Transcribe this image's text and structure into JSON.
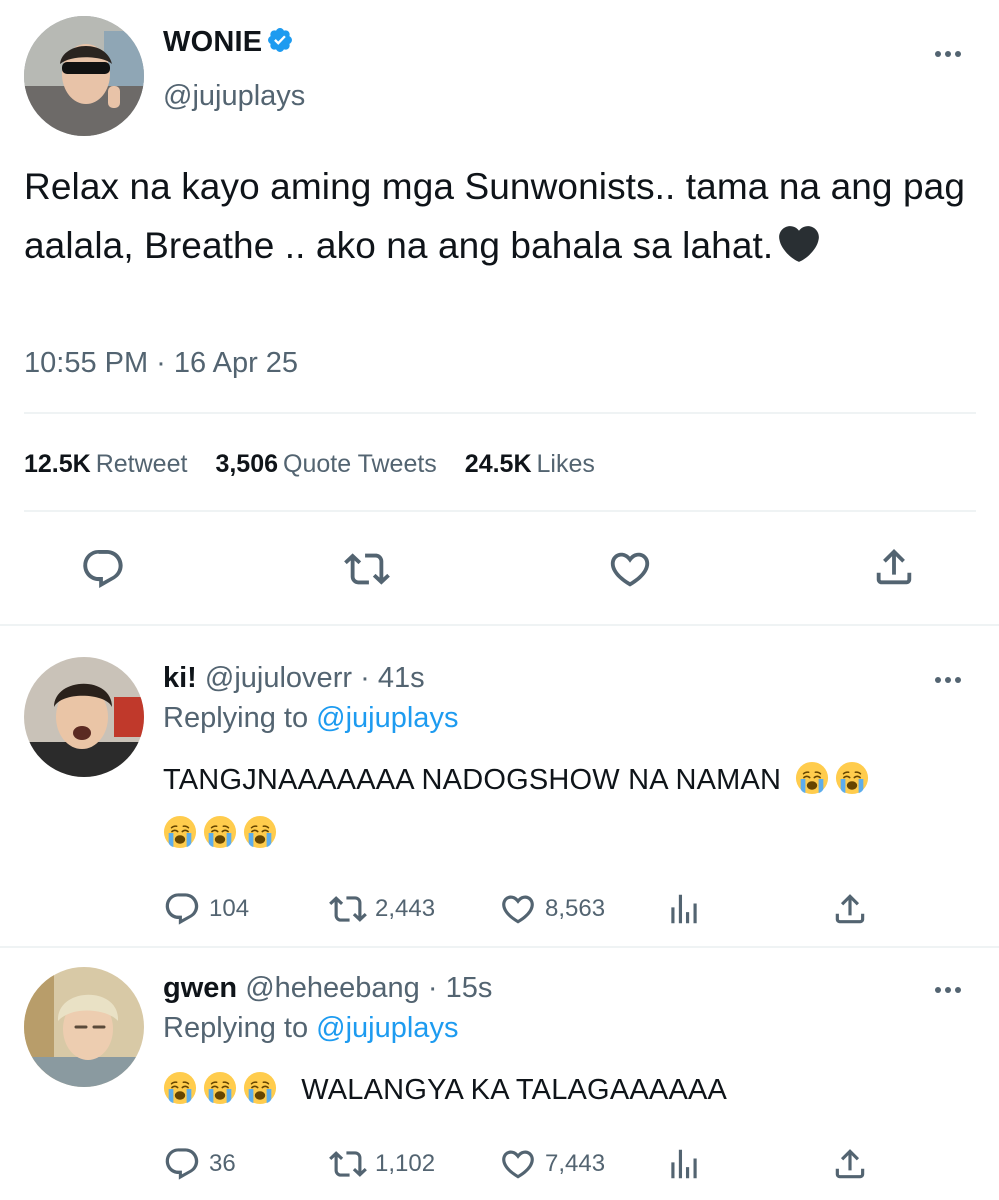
{
  "tweet": {
    "author": {
      "name": "WONIE",
      "handle": "@jujuplays",
      "verified": true,
      "avatar": "profile-photo-sunglasses"
    },
    "text": "Relax na kayo aming mga Sunwonists.. tama na ang pag aalala, Breathe .. ako na ang bahala sa lahat.",
    "trailing_emoji": "black-heart",
    "timestamp": "10:55 PM · 16 Apr 25",
    "stats": {
      "retweets": "12.5K",
      "retweets_label": "Retweet",
      "quotes": "3,506",
      "quotes_label": "Quote Tweets",
      "likes": "24.5K",
      "likes_label": "Likes"
    },
    "actions": [
      "reply-icon",
      "retweet-icon",
      "like-icon",
      "share-icon"
    ]
  },
  "replies": [
    {
      "name": "ki!",
      "handle": "@jujuloverr",
      "time": "41s",
      "replying_prefix": "Replying to",
      "replying_to": "@jujuplays",
      "text": "TANGJNAAAAAAA NADOGSHOW NA NAMAN",
      "emojis_after_count": 2,
      "emojis_second_line_count": 3,
      "replies": "104",
      "retweets": "2,443",
      "likes": "8,563"
    },
    {
      "name": "gwen",
      "handle": "@heheebang",
      "time": "15s",
      "replying_prefix": "Replying to",
      "replying_to": "@jujuplays",
      "text": "WALANGYA KA TALAGAAAAAA",
      "emojis_before_count": 3,
      "replies": "36",
      "retweets": "1,102",
      "likes": "7,443"
    }
  ],
  "colors": {
    "text": "#0f1419",
    "secondary": "#536471",
    "link": "#1d9bf0",
    "verified": "#1d9bf0",
    "divider": "#eff3f4"
  }
}
